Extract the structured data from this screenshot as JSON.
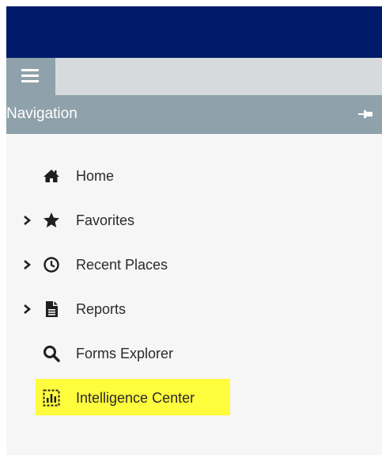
{
  "header": {
    "bar_color": "#001b6a",
    "menu_icon": "hamburger-menu-icon"
  },
  "navigation": {
    "title": "Navigation",
    "pin_icon": "pin-icon",
    "items": [
      {
        "label": "Home",
        "icon": "home-icon",
        "expandable": false
      },
      {
        "label": "Favorites",
        "icon": "star-icon",
        "expandable": true
      },
      {
        "label": "Recent Places",
        "icon": "clock-icon",
        "expandable": true
      },
      {
        "label": "Reports",
        "icon": "document-icon",
        "expandable": true
      },
      {
        "label": "Forms Explorer",
        "icon": "search-icon",
        "expandable": false
      },
      {
        "label": "Intelligence Center",
        "icon": "dashboard-icon",
        "expandable": false,
        "highlighted": true
      }
    ]
  },
  "colors": {
    "nav_header": "#8fa1ab",
    "highlight": "#fffb3d",
    "panel_background": "#f6f6f6"
  }
}
